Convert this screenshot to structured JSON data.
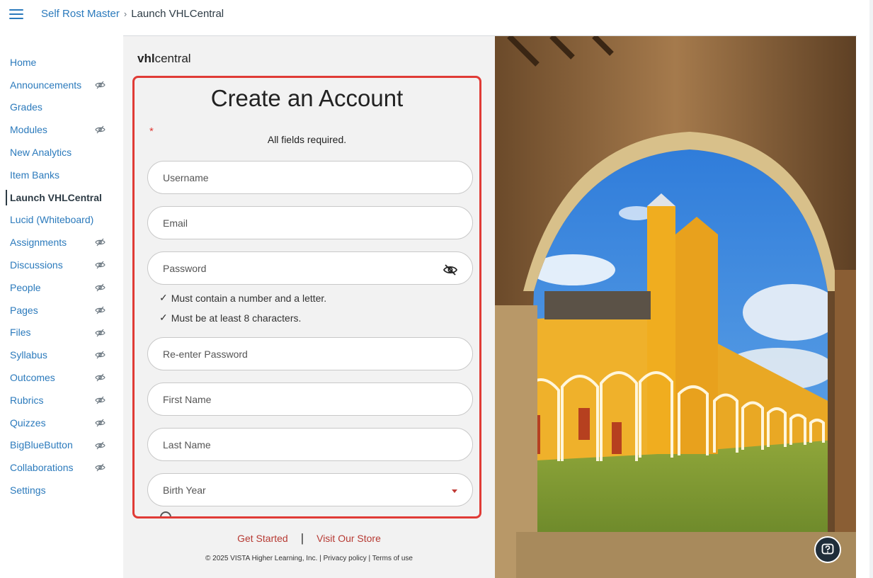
{
  "breadcrumb": {
    "course": "Self Rost Master",
    "separator": "›",
    "current": "Launch VHLCentral"
  },
  "sidebar": {
    "items": [
      {
        "label": "Home",
        "hidden_icon": false,
        "active": false
      },
      {
        "label": "Announcements",
        "hidden_icon": true,
        "active": false
      },
      {
        "label": "Grades",
        "hidden_icon": false,
        "active": false
      },
      {
        "label": "Modules",
        "hidden_icon": true,
        "active": false
      },
      {
        "label": "New Analytics",
        "hidden_icon": false,
        "active": false
      },
      {
        "label": "Item Banks",
        "hidden_icon": false,
        "active": false
      },
      {
        "label": "Launch VHLCentral",
        "hidden_icon": false,
        "active": true
      },
      {
        "label": "Lucid (Whiteboard)",
        "hidden_icon": false,
        "active": false
      },
      {
        "label": "Assignments",
        "hidden_icon": true,
        "active": false
      },
      {
        "label": "Discussions",
        "hidden_icon": true,
        "active": false
      },
      {
        "label": "People",
        "hidden_icon": true,
        "active": false
      },
      {
        "label": "Pages",
        "hidden_icon": true,
        "active": false
      },
      {
        "label": "Files",
        "hidden_icon": true,
        "active": false
      },
      {
        "label": "Syllabus",
        "hidden_icon": true,
        "active": false
      },
      {
        "label": "Outcomes",
        "hidden_icon": true,
        "active": false
      },
      {
        "label": "Rubrics",
        "hidden_icon": true,
        "active": false
      },
      {
        "label": "Quizzes",
        "hidden_icon": true,
        "active": false
      },
      {
        "label": "BigBlueButton",
        "hidden_icon": true,
        "active": false
      },
      {
        "label": "Collaborations",
        "hidden_icon": true,
        "active": false
      },
      {
        "label": "Settings",
        "hidden_icon": false,
        "active": false
      }
    ]
  },
  "vhl": {
    "logo_bold": "vhl",
    "logo_rest": "central",
    "form": {
      "title": "Create an Account",
      "required_marker": "*",
      "required_note": "All fields required.",
      "username_placeholder": "Username",
      "email_placeholder": "Email",
      "password_placeholder": "Password",
      "rule_1": "Must contain a number and a letter.",
      "rule_2": "Must be at least 8 characters.",
      "check_glyph": "✓",
      "reenter_placeholder": "Re-enter Password",
      "first_name_placeholder": "First Name",
      "last_name_placeholder": "Last Name",
      "birth_year_placeholder": "Birth Year"
    },
    "footer": {
      "get_started": "Get Started",
      "divider": "|",
      "visit_store": "Visit Our Store",
      "copyright": "© 2025 VISTA Higher Learning, Inc.",
      "pipe1": "|",
      "privacy": "Privacy policy",
      "pipe2": "|",
      "terms": "Terms of use"
    }
  },
  "colors": {
    "link": "#2b7abc",
    "highlight_border": "#e03b36",
    "footer_link": "#b73a33",
    "help_button": "#1f2d3a"
  },
  "icons": [
    "hamburger-menu-icon",
    "eye-slash-icon",
    "dropdown-caret-icon",
    "help-icon",
    "check-icon"
  ]
}
